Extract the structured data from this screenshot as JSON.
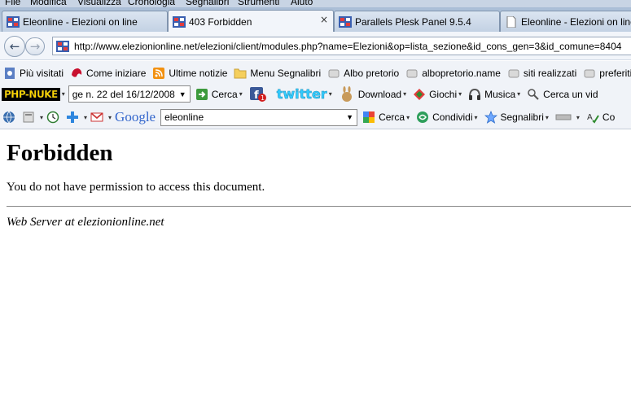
{
  "menubar": {
    "items": [
      "File",
      "Modifica",
      "Visualizza",
      "Cronologia",
      "Segnalibri",
      "Strumenti",
      "Aiuto"
    ]
  },
  "tabs": [
    {
      "label": "Eleonline - Elezioni on line",
      "favicon": "eleonline-favicon",
      "active": false
    },
    {
      "label": "403 Forbidden",
      "favicon": "eleonline-favicon",
      "active": true,
      "close": "×"
    },
    {
      "label": "Parallels Plesk Panel 9.5.4",
      "favicon": "plesk-favicon",
      "active": false
    },
    {
      "label": "Eleonline - Elezioni on line",
      "favicon": "page-icon",
      "active": false
    }
  ],
  "navbar": {
    "back": "←",
    "forward": "→",
    "url": "http://www.elezionionline.net/elezioni/client/modules.php?name=Elezioni&op=lista_sezione&id_cons_gen=3&id_comune=8404"
  },
  "bookmarks": [
    {
      "label": "Più visitati",
      "icon": "frequent-icon",
      "dropdown": false
    },
    {
      "label": "Come iniziare",
      "icon": "firefox-start-icon",
      "dropdown": false
    },
    {
      "label": "Ultime notizie",
      "icon": "rss-icon",
      "dropdown": false
    },
    {
      "label": "Menu Segnalibri",
      "icon": "folder-icon",
      "dropdown": false
    },
    {
      "label": "Albo pretorio",
      "icon": "page-grey-icon",
      "dropdown": false
    },
    {
      "label": "albopretorio.name",
      "icon": "page-grey-icon",
      "dropdown": false
    },
    {
      "label": "siti realizzati",
      "icon": "page-grey-icon",
      "dropdown": false
    },
    {
      "label": "preferiti i",
      "icon": "page-grey-icon",
      "dropdown": false
    }
  ],
  "toolbar2": {
    "logo": "PHP-NUKE",
    "select_value": "ge n. 22 del 16/12/2008",
    "cerca": "Cerca",
    "twitter": "twitter",
    "download": "Download",
    "giochi": "Giochi",
    "musica": "Musica",
    "cerca_video": "Cerca un vid"
  },
  "toolbar3": {
    "google": "Google",
    "search_value": "eleonline",
    "cerca": "Cerca",
    "condividi": "Condividi",
    "segnalibri": "Segnalibri",
    "last": "Co"
  },
  "page": {
    "heading": "Forbidden",
    "message": "You do not have permission to access this document.",
    "server": "Web Server at elezionionline.net"
  },
  "colors": {
    "chrome_bg": "#f0f3f8",
    "tab_bar": "#b6c8dd",
    "google_blue": "#3366cc",
    "twitter_blue": "#33ccff"
  }
}
